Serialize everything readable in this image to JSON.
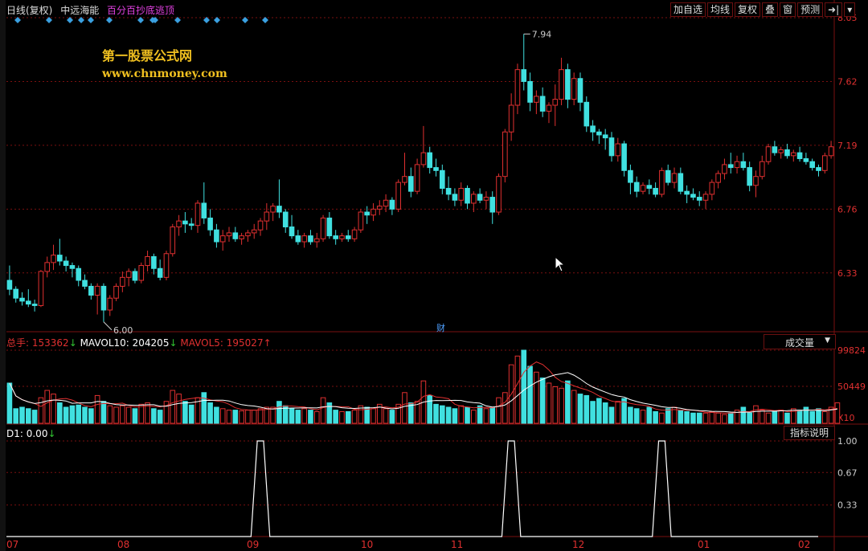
{
  "header": {
    "period": "日线(复权)",
    "stock": "中远海能",
    "formula": "百分百抄底逃顶"
  },
  "toolbar": {
    "buttons": [
      "加自选",
      "均线",
      "复权",
      "叠",
      "窗",
      "预测",
      "➜|",
      "▾"
    ]
  },
  "logo": {
    "line1": "第一股票公式网",
    "line2": "www.chnmoney.com"
  },
  "volume_header": {
    "label": "总手",
    "value": "153362",
    "value_arrow": "↓",
    "ma10_label": "MAVOL10",
    "ma10_value": "204205",
    "ma10_arrow": "↓",
    "ma5_label": "MAVOL5",
    "ma5_value": "195027",
    "ma5_arrow": "↑"
  },
  "volume_select": "成交量",
  "indicator_header": {
    "label": "D1",
    "value": "0.00",
    "arrow": "↓"
  },
  "indicator_button": "指标说明",
  "cai_marker": "财",
  "colors": {
    "up": "#e03030",
    "down": "#40e0e0",
    "grid": "#7a1010",
    "axis_text": "#e03030",
    "diamond": "#3aa0e0",
    "ma10": "#ffffff",
    "ma5": "#e03030",
    "indicator": "#ffffff"
  },
  "chart_data": [
    {
      "type": "candlestick",
      "yticks": [
        6.33,
        6.76,
        7.19,
        7.62,
        8.05
      ],
      "ylim": [
        5.95,
        8.05
      ],
      "xticks": [
        "07",
        "08",
        "09",
        "10",
        "11",
        "12",
        "01",
        "02"
      ],
      "annotations": [
        {
          "label": "7.94"
        },
        {
          "label": "6.00"
        }
      ],
      "ohlc": [
        [
          6.28,
          6.38,
          6.18,
          6.22
        ],
        [
          6.22,
          6.24,
          6.13,
          6.16
        ],
        [
          6.16,
          6.2,
          6.11,
          6.14
        ],
        [
          6.14,
          6.22,
          6.1,
          6.12
        ],
        [
          6.12,
          6.15,
          6.07,
          6.11
        ],
        [
          6.11,
          6.35,
          6.1,
          6.34
        ],
        [
          6.34,
          6.44,
          6.3,
          6.4
        ],
        [
          6.4,
          6.52,
          6.35,
          6.45
        ],
        [
          6.45,
          6.56,
          6.38,
          6.41
        ],
        [
          6.41,
          6.44,
          6.34,
          6.38
        ],
        [
          6.38,
          6.4,
          6.3,
          6.36
        ],
        [
          6.36,
          6.38,
          6.24,
          6.28
        ],
        [
          6.28,
          6.32,
          6.22,
          6.24
        ],
        [
          6.24,
          6.26,
          6.15,
          6.18
        ],
        [
          6.18,
          6.26,
          6.05,
          6.24
        ],
        [
          6.24,
          6.26,
          6.0,
          6.08
        ],
        [
          6.08,
          6.18,
          6.04,
          6.16
        ],
        [
          6.16,
          6.26,
          6.14,
          6.24
        ],
        [
          6.24,
          6.34,
          6.2,
          6.3
        ],
        [
          6.3,
          6.36,
          6.24,
          6.34
        ],
        [
          6.34,
          6.36,
          6.26,
          6.28
        ],
        [
          6.28,
          6.4,
          6.26,
          6.38
        ],
        [
          6.38,
          6.48,
          6.34,
          6.44
        ],
        [
          6.44,
          6.46,
          6.32,
          6.36
        ],
        [
          6.36,
          6.42,
          6.28,
          6.3
        ],
        [
          6.3,
          6.48,
          6.28,
          6.46
        ],
        [
          6.46,
          6.66,
          6.44,
          6.64
        ],
        [
          6.64,
          6.72,
          6.58,
          6.68
        ],
        [
          6.68,
          6.74,
          6.6,
          6.66
        ],
        [
          6.66,
          6.7,
          6.62,
          6.65
        ],
        [
          6.65,
          6.82,
          6.6,
          6.8
        ],
        [
          6.8,
          6.94,
          6.66,
          6.7
        ],
        [
          6.7,
          6.76,
          6.58,
          6.62
        ],
        [
          6.62,
          6.66,
          6.5,
          6.54
        ],
        [
          6.54,
          6.62,
          6.48,
          6.58
        ],
        [
          6.58,
          6.64,
          6.54,
          6.6
        ],
        [
          6.6,
          6.64,
          6.54,
          6.56
        ],
        [
          6.56,
          6.6,
          6.52,
          6.58
        ],
        [
          6.58,
          6.62,
          6.54,
          6.6
        ],
        [
          6.6,
          6.66,
          6.56,
          6.62
        ],
        [
          6.62,
          6.7,
          6.58,
          6.68
        ],
        [
          6.68,
          6.8,
          6.62,
          6.74
        ],
        [
          6.74,
          6.8,
          6.68,
          6.78
        ],
        [
          6.78,
          6.96,
          6.7,
          6.74
        ],
        [
          6.74,
          6.76,
          6.6,
          6.64
        ],
        [
          6.64,
          6.72,
          6.56,
          6.58
        ],
        [
          6.58,
          6.62,
          6.52,
          6.54
        ],
        [
          6.54,
          6.6,
          6.5,
          6.58
        ],
        [
          6.58,
          6.62,
          6.52,
          6.54
        ],
        [
          6.54,
          6.6,
          6.5,
          6.56
        ],
        [
          6.56,
          6.72,
          6.54,
          6.7
        ],
        [
          6.7,
          6.74,
          6.56,
          6.58
        ],
        [
          6.58,
          6.62,
          6.52,
          6.56
        ],
        [
          6.56,
          6.6,
          6.54,
          6.58
        ],
        [
          6.58,
          6.62,
          6.54,
          6.56
        ],
        [
          6.56,
          6.64,
          6.54,
          6.62
        ],
        [
          6.62,
          6.76,
          6.6,
          6.74
        ],
        [
          6.74,
          6.78,
          6.66,
          6.72
        ],
        [
          6.72,
          6.8,
          6.68,
          6.76
        ],
        [
          6.76,
          6.82,
          6.72,
          6.78
        ],
        [
          6.78,
          6.86,
          6.74,
          6.82
        ],
        [
          6.82,
          6.84,
          6.72,
          6.76
        ],
        [
          6.76,
          6.96,
          6.74,
          6.94
        ],
        [
          6.94,
          7.14,
          6.92,
          6.98
        ],
        [
          6.98,
          7.04,
          6.84,
          6.88
        ],
        [
          6.88,
          7.1,
          6.86,
          7.06
        ],
        [
          7.06,
          7.32,
          7.04,
          7.14
        ],
        [
          7.14,
          7.18,
          7.0,
          7.04
        ],
        [
          7.04,
          7.1,
          6.98,
          7.02
        ],
        [
          7.02,
          7.06,
          6.86,
          6.9
        ],
        [
          6.9,
          6.98,
          6.82,
          6.86
        ],
        [
          6.86,
          6.9,
          6.78,
          6.82
        ],
        [
          6.82,
          6.94,
          6.78,
          6.9
        ],
        [
          6.9,
          6.92,
          6.76,
          6.8
        ],
        [
          6.8,
          6.88,
          6.74,
          6.86
        ],
        [
          6.86,
          6.9,
          6.8,
          6.82
        ],
        [
          6.82,
          6.88,
          6.76,
          6.84
        ],
        [
          6.84,
          6.88,
          6.66,
          6.74
        ],
        [
          6.74,
          7.0,
          6.72,
          6.98
        ],
        [
          6.98,
          7.3,
          6.94,
          7.28
        ],
        [
          7.28,
          7.54,
          7.22,
          7.46
        ],
        [
          7.46,
          7.74,
          7.4,
          7.7
        ],
        [
          7.7,
          7.94,
          7.56,
          7.62
        ],
        [
          7.62,
          7.68,
          7.42,
          7.48
        ],
        [
          7.48,
          7.56,
          7.4,
          7.52
        ],
        [
          7.52,
          7.58,
          7.38,
          7.42
        ],
        [
          7.42,
          7.48,
          7.34,
          7.46
        ],
        [
          7.46,
          7.6,
          7.32,
          7.5
        ],
        [
          7.5,
          7.78,
          7.46,
          7.7
        ],
        [
          7.7,
          7.74,
          7.44,
          7.5
        ],
        [
          7.5,
          7.68,
          7.46,
          7.64
        ],
        [
          7.64,
          7.68,
          7.42,
          7.48
        ],
        [
          7.48,
          7.52,
          7.28,
          7.32
        ],
        [
          7.32,
          7.36,
          7.22,
          7.28
        ],
        [
          7.28,
          7.3,
          7.2,
          7.26
        ],
        [
          7.26,
          7.3,
          7.16,
          7.24
        ],
        [
          7.24,
          7.28,
          7.08,
          7.12
        ],
        [
          7.12,
          7.24,
          7.08,
          7.2
        ],
        [
          7.2,
          7.22,
          6.98,
          7.02
        ],
        [
          7.02,
          7.06,
          6.86,
          6.94
        ],
        [
          6.94,
          6.98,
          6.84,
          6.88
        ],
        [
          6.88,
          6.94,
          6.86,
          6.92
        ],
        [
          6.92,
          6.96,
          6.86,
          6.9
        ],
        [
          6.9,
          6.94,
          6.84,
          6.86
        ],
        [
          6.86,
          7.04,
          6.84,
          7.02
        ],
        [
          7.02,
          7.06,
          6.92,
          6.94
        ],
        [
          6.94,
          7.04,
          6.9,
          7.0
        ],
        [
          7.0,
          7.04,
          6.86,
          6.88
        ],
        [
          6.88,
          6.92,
          6.8,
          6.86
        ],
        [
          6.86,
          6.9,
          6.82,
          6.84
        ],
        [
          6.84,
          6.88,
          6.78,
          6.82
        ],
        [
          6.82,
          6.88,
          6.76,
          6.86
        ],
        [
          6.86,
          6.96,
          6.82,
          6.94
        ],
        [
          6.94,
          7.02,
          6.9,
          7.0
        ],
        [
          7.0,
          7.1,
          6.96,
          7.06
        ],
        [
          7.06,
          7.14,
          7.0,
          7.04
        ],
        [
          7.04,
          7.12,
          7.0,
          7.08
        ],
        [
          7.08,
          7.14,
          7.02,
          7.04
        ],
        [
          7.04,
          7.08,
          6.88,
          6.92
        ],
        [
          6.92,
          7.02,
          6.84,
          6.98
        ],
        [
          6.98,
          7.12,
          6.96,
          7.08
        ],
        [
          7.08,
          7.2,
          7.06,
          7.18
        ],
        [
          7.18,
          7.22,
          7.12,
          7.14
        ],
        [
          7.14,
          7.18,
          7.1,
          7.16
        ],
        [
          7.16,
          7.2,
          7.1,
          7.12
        ],
        [
          7.12,
          7.16,
          7.08,
          7.14
        ],
        [
          7.14,
          7.18,
          7.08,
          7.1
        ],
        [
          7.1,
          7.14,
          7.06,
          7.08
        ],
        [
          7.08,
          7.1,
          7.02,
          7.04
        ],
        [
          7.04,
          7.06,
          6.98,
          7.02
        ],
        [
          7.02,
          7.14,
          7.0,
          7.12
        ],
        [
          7.12,
          7.22,
          7.1,
          7.18
        ]
      ],
      "top_signal_bars": [
        14,
        53,
        79,
        93,
        105,
        128,
        167,
        182,
        185,
        213,
        249,
        262,
        297,
        322
      ]
    },
    {
      "type": "bar",
      "name": "volume",
      "yticks": [
        50449,
        99824
      ],
      "ylim": [
        0,
        99824
      ],
      "unit_label": "X10",
      "values": [
        55,
        20,
        22,
        20,
        18,
        35,
        45,
        40,
        28,
        22,
        24,
        25,
        22,
        20,
        38,
        30,
        24,
        22,
        24,
        22,
        20,
        26,
        28,
        20,
        18,
        30,
        45,
        40,
        30,
        25,
        35,
        42,
        28,
        22,
        20,
        18,
        18,
        17,
        18,
        18,
        20,
        22,
        22,
        30,
        24,
        20,
        18,
        20,
        18,
        16,
        35,
        28,
        18,
        16,
        16,
        18,
        24,
        22,
        20,
        26,
        20,
        18,
        26,
        42,
        28,
        30,
        58,
        38,
        26,
        24,
        22,
        20,
        24,
        22,
        18,
        24,
        20,
        22,
        35,
        42,
        80,
        92,
        100,
        78,
        70,
        62,
        55,
        50,
        48,
        58,
        45,
        40,
        38,
        30,
        34,
        28,
        22,
        30,
        34,
        22,
        20,
        18,
        22,
        16,
        14,
        20,
        22,
        18,
        16,
        14,
        14,
        14,
        16,
        14,
        12,
        14,
        18,
        22,
        14,
        24,
        18,
        14,
        16,
        18,
        14,
        20,
        18,
        22,
        16,
        20,
        16,
        22,
        28
      ],
      "ma10_last": 204205,
      "ma5_last": 195027
    },
    {
      "type": "line",
      "name": "D1",
      "yticks": [
        0.33,
        0.67,
        1.0
      ],
      "ylim": [
        0,
        1
      ],
      "spikes": [
        {
          "bar": 40,
          "value": 1.0
        },
        {
          "bar": 80,
          "value": 1.0
        },
        {
          "bar": 104,
          "value": 1.0
        }
      ]
    }
  ]
}
